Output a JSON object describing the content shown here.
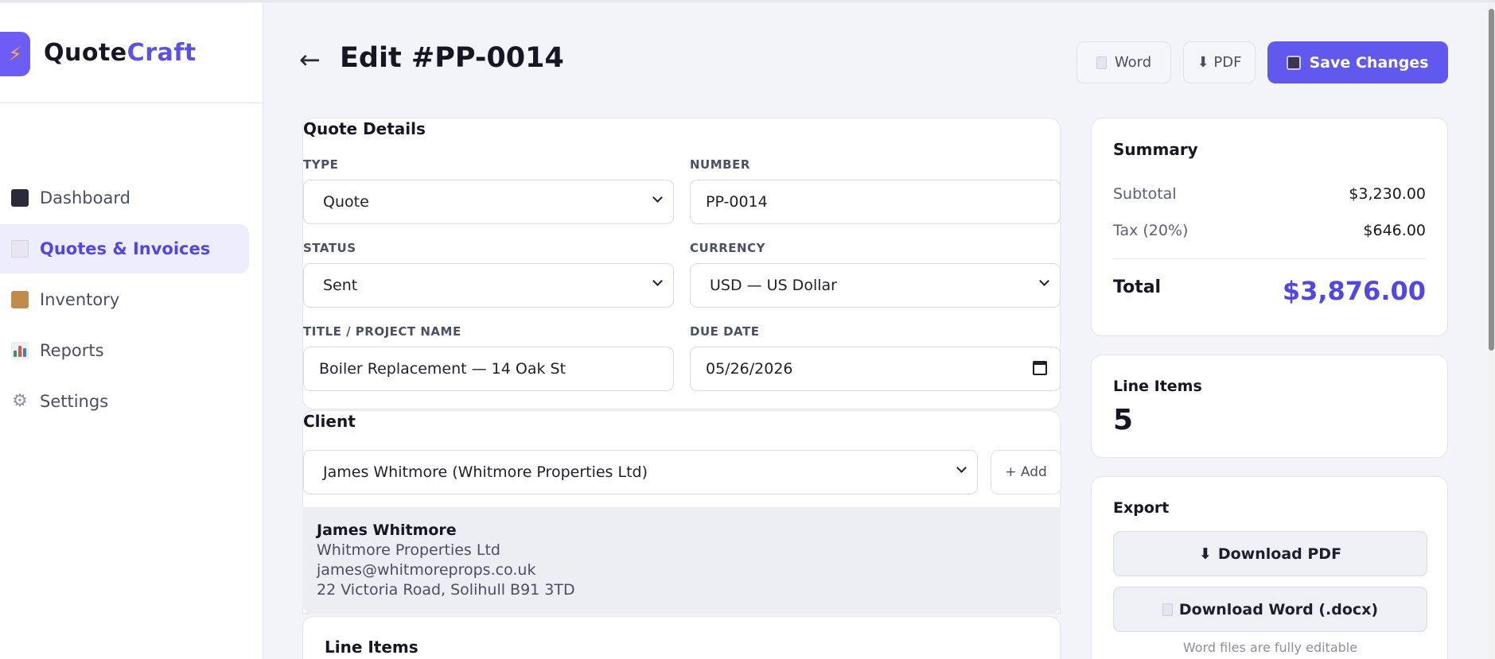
{
  "brand": {
    "name_part1": "Quote",
    "name_part2": "Craft",
    "logo_icon": "lightning-bolt-icon"
  },
  "sidebar": {
    "items": [
      {
        "label": "Dashboard",
        "icon": "dashboard-icon",
        "active": false
      },
      {
        "label": "Quotes & Invoices",
        "icon": "document-icon",
        "active": true
      },
      {
        "label": "Inventory",
        "icon": "package-icon",
        "active": false
      },
      {
        "label": "Reports",
        "icon": "bar-chart-icon",
        "active": false
      },
      {
        "label": "Settings",
        "icon": "gear-icon",
        "active": false
      }
    ]
  },
  "header": {
    "back_arrow": "←",
    "title": "Edit #PP-0014",
    "word_button": "Word",
    "pdf_button": "⬇ PDF",
    "save_button": "Save Changes"
  },
  "quote_details": {
    "section_title": "Quote Details",
    "type_label": "TYPE",
    "type_value": "Quote",
    "number_label": "NUMBER",
    "number_value": "PP-0014",
    "status_label": "STATUS",
    "status_value": "Sent",
    "currency_label": "CURRENCY",
    "currency_value": "USD — US Dollar",
    "title_label": "TITLE / PROJECT NAME",
    "title_value": "Boiler Replacement — 14 Oak St",
    "due_label": "DUE DATE",
    "due_value": "05/26/2026"
  },
  "client": {
    "section_title": "Client",
    "selected": "James Whitmore (Whitmore Properties Ltd)",
    "add_button": "+ Add",
    "name": "James Whitmore",
    "company": "Whitmore Properties Ltd",
    "email": "james@whitmoreprops.co.uk",
    "address": "22 Victoria Road, Solihull B91 3TD"
  },
  "line_items_section": {
    "title": "Line Items"
  },
  "summary": {
    "title": "Summary",
    "subtotal_label": "Subtotal",
    "subtotal_value": "$3,230.00",
    "tax_label": "Tax (20%)",
    "tax_value": "$646.00",
    "total_label": "Total",
    "total_value": "$3,876.00"
  },
  "line_items_card": {
    "title": "Line Items",
    "count": "5"
  },
  "export": {
    "title": "Export",
    "pdf_button": "Download PDF",
    "word_button": "Download Word (.docx)",
    "note": "Word files are fully editable"
  },
  "colors": {
    "accent": "#6158ee",
    "accent_text": "#5147e3",
    "logo_bg": "#6d5df5",
    "bolt": "#ffb33a",
    "page_bg": "#f3f4f9"
  }
}
